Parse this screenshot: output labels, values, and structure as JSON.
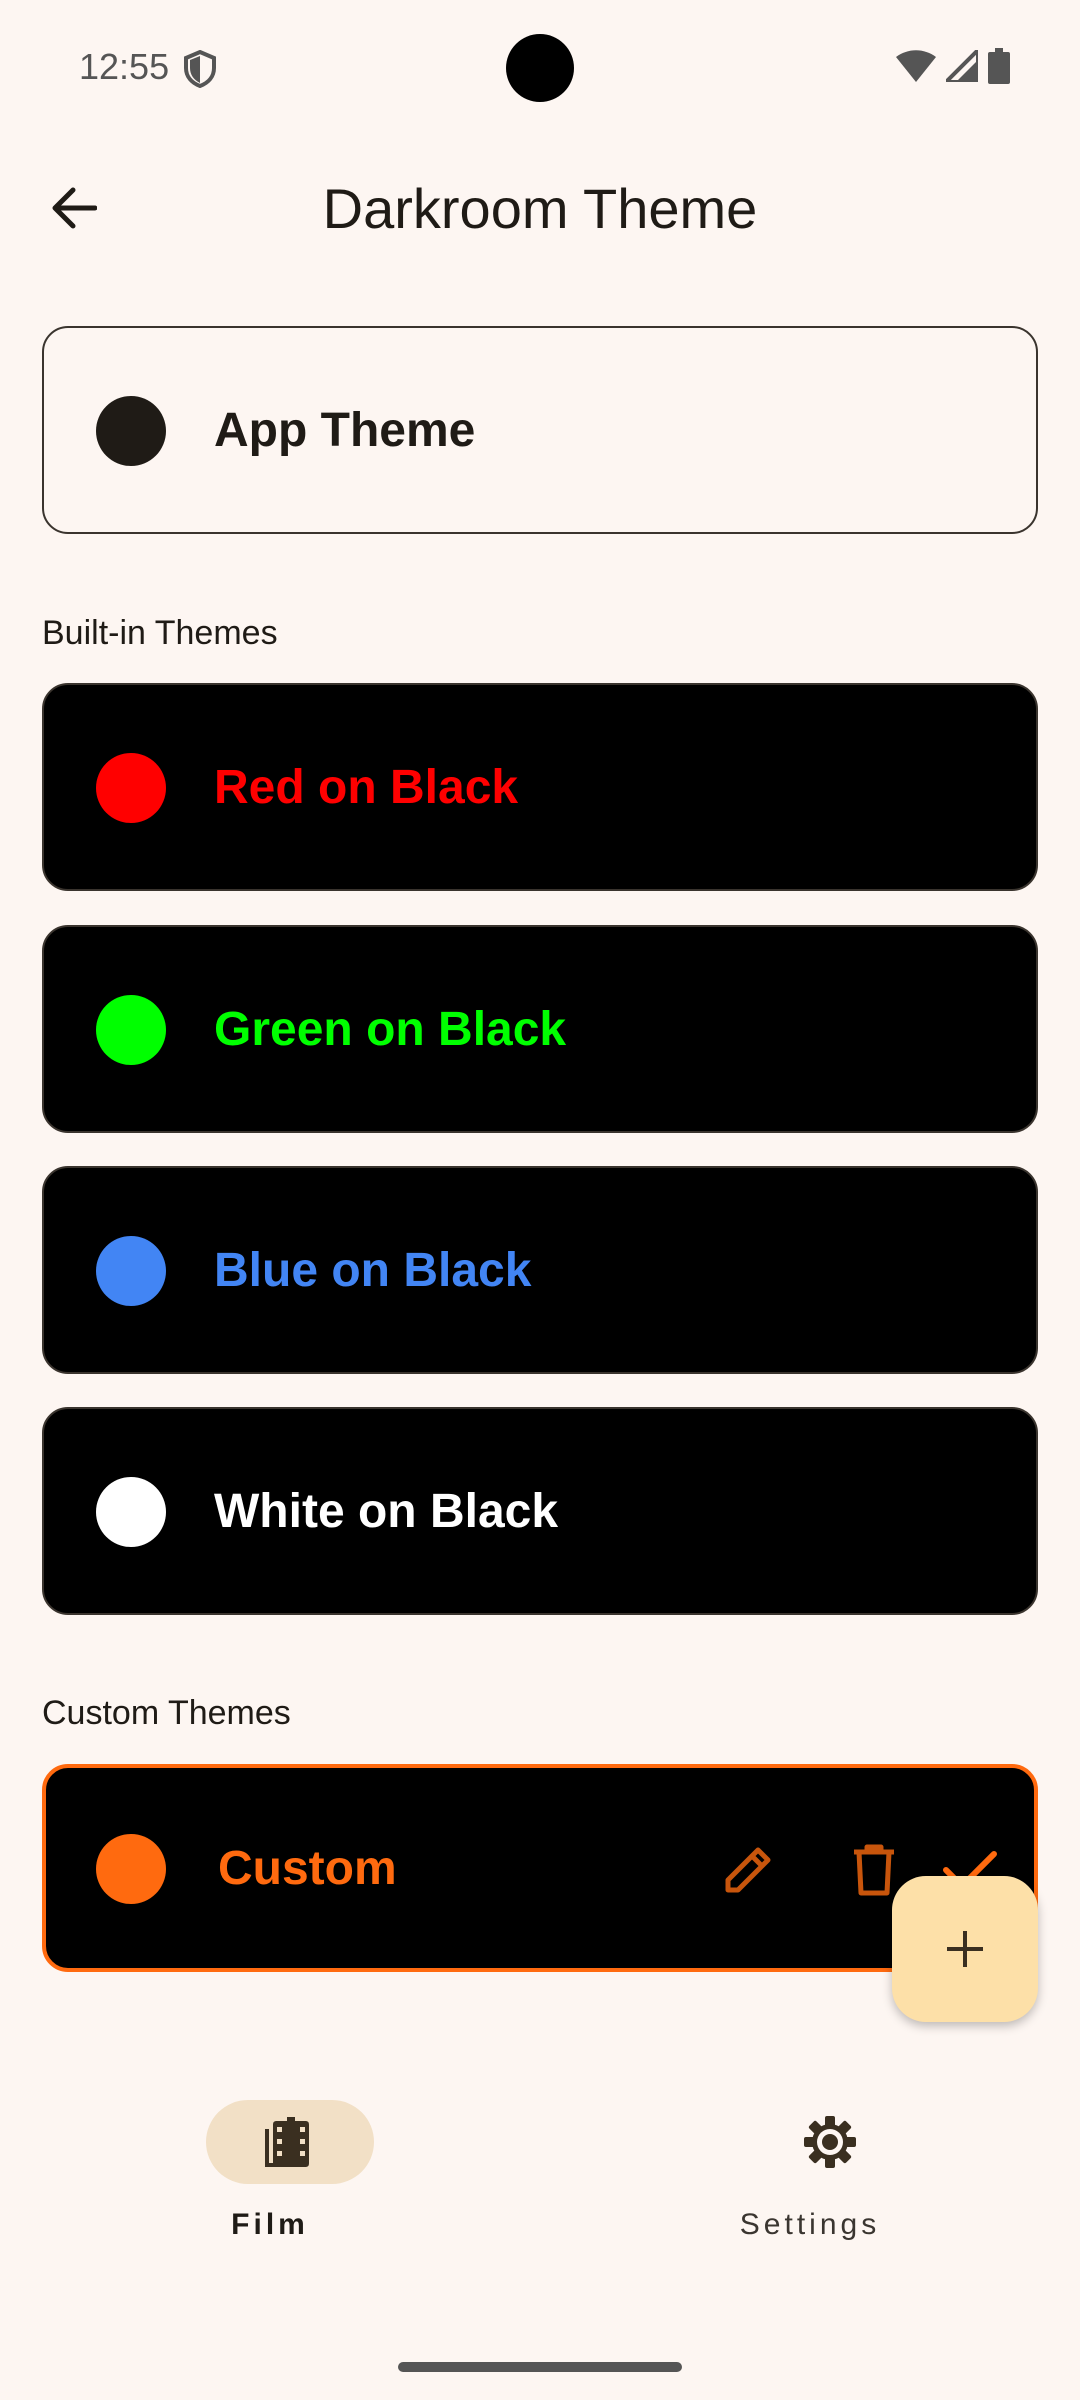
{
  "status_bar": {
    "time": "12:55",
    "icons": [
      "shield-icon",
      "wifi-icon",
      "signal-icon",
      "battery-icon"
    ]
  },
  "app_bar": {
    "back_icon": "arrow-left-icon",
    "title": "Darkroom Theme"
  },
  "app_theme": {
    "label": "App Theme",
    "dot_color": "#1f1b16"
  },
  "built_in": {
    "section_label": "Built-in Themes",
    "items": [
      {
        "label": "Red on Black",
        "color": "#ff0000"
      },
      {
        "label": "Green on Black",
        "color": "#00ff00"
      },
      {
        "label": "Blue on Black",
        "color": "#4285f4"
      },
      {
        "label": "White on Black",
        "color": "#ffffff"
      }
    ]
  },
  "custom": {
    "section_label": "Custom Themes",
    "items": [
      {
        "label": "Custom",
        "color": "#ff6a0f",
        "selected": true,
        "actions": [
          "edit-icon",
          "delete-icon",
          "check-icon"
        ]
      }
    ]
  },
  "fab": {
    "icon": "plus-icon"
  },
  "bottom_nav": {
    "items": [
      {
        "label": "Film",
        "icon": "film-icon",
        "active": true
      },
      {
        "label": "Settings",
        "icon": "gear-icon",
        "active": false
      }
    ]
  }
}
